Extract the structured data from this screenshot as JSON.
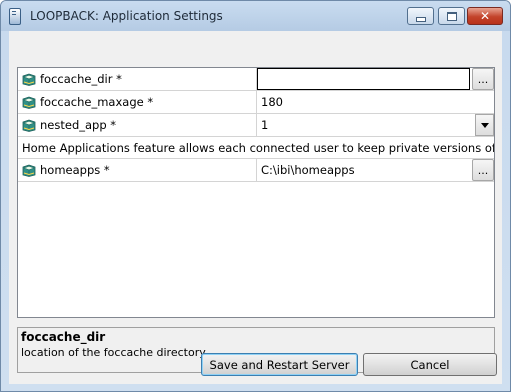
{
  "window": {
    "title": "LOOPBACK: Application Settings",
    "icon": "app-icon",
    "buttons": {
      "minimize_icon": "minimize-icon",
      "maximize_icon": "maximize-icon",
      "close_icon": "close-icon"
    }
  },
  "settings": {
    "rows": [
      {
        "name": "foccache_dir *",
        "value": "",
        "editor": "ellipsis",
        "ellipsis_label": "..."
      },
      {
        "name": "foccache_maxage *",
        "value": "180"
      },
      {
        "name": "nested_app *",
        "value": "1",
        "editor": "dropdown"
      },
      {
        "info": "Home Applications feature allows each connected user to keep private versions of hold..."
      },
      {
        "name": "homeapps *",
        "value": "C:\\ibi\\homeapps",
        "editor": "ellipsis",
        "ellipsis_label": "..."
      }
    ]
  },
  "help": {
    "title": "foccache_dir",
    "description": "location of the foccache directory"
  },
  "buttons": {
    "save_label": "Save and Restart Server",
    "cancel_label": "Cancel"
  },
  "colors": {
    "title_bar": "#bed3ea",
    "close_button": "#c3432a",
    "primary_border": "#3c7fb1"
  }
}
